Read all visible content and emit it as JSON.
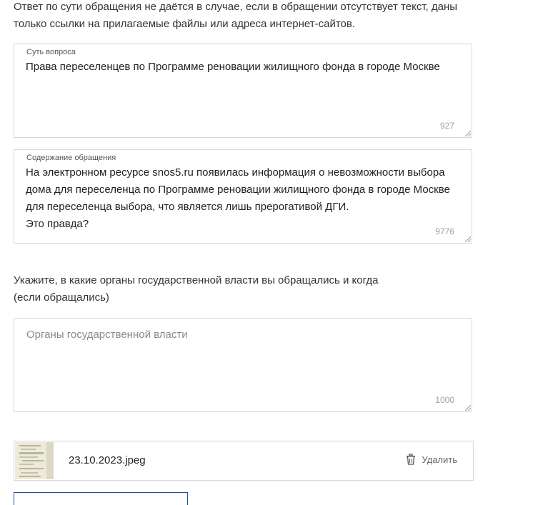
{
  "notice": {
    "text": "Ответ по сути обращения не даётся в случае, если в обращении отсутствует текст, даны только ссылки на прилагаемые файлы или адреса интернет-сайтов."
  },
  "subject_field": {
    "label": "Суть вопроса",
    "value": "Права переселенцев по Программе реновации жилищного фонда в городе Москве",
    "counter": "927"
  },
  "content_field": {
    "label": "Содержание обращения",
    "value": "На электронном ресурсе snos5.ru появилась информация о невозможности выбора дома для переселенца по Программе реновации жилищного фонда в городе Москве для переселенца выбора, что является лишь прерогативой ДГИ.\nЭто правда?",
    "counter": "9776"
  },
  "authorities": {
    "question": "Укажите, в какие органы государственной власти вы обращались и когда\n(если обращались)",
    "placeholder": "Органы государственной власти",
    "counter": "1000"
  },
  "attachment": {
    "file_name": "23.10.2023.jpeg",
    "delete_label": "Удалить",
    "icon": "trash-icon"
  },
  "colors": {
    "border": "#d8d8d8",
    "button_border": "#1f4f9c",
    "placeholder": "#8a8a8a",
    "counter": "#a0a0a0"
  }
}
